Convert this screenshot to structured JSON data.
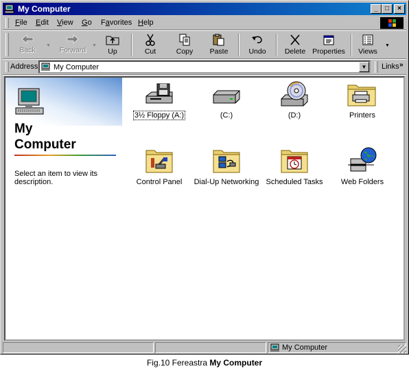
{
  "window": {
    "title": "My Computer",
    "controls": {
      "minimize": "_",
      "maximize": "□",
      "close": "×"
    }
  },
  "menubar": {
    "items": [
      {
        "label": "File",
        "underline": "F"
      },
      {
        "label": "Edit",
        "underline": "E"
      },
      {
        "label": "View",
        "underline": "V"
      },
      {
        "label": "Go",
        "underline": "G"
      },
      {
        "label": "Favorites",
        "underline": "a"
      },
      {
        "label": "Help",
        "underline": "H"
      }
    ]
  },
  "toolbar": {
    "back": "Back",
    "forward": "Forward",
    "up": "Up",
    "cut": "Cut",
    "copy": "Copy",
    "paste": "Paste",
    "undo": "Undo",
    "delete": "Delete",
    "properties": "Properties",
    "views": "Views"
  },
  "addressbar": {
    "label": "Address",
    "value": "My Computer",
    "links": "Links"
  },
  "leftpane": {
    "title_line1": "My",
    "title_line2": "Computer",
    "description": "Select an item to view its description."
  },
  "items": [
    {
      "label": "3½ Floppy (A:)",
      "icon": "floppy-drive-icon"
    },
    {
      "label": "(C:)",
      "icon": "hard-drive-icon"
    },
    {
      "label": "(D:)",
      "icon": "cd-drive-icon"
    },
    {
      "label": "Printers",
      "icon": "printers-folder-icon"
    },
    {
      "label": "Control Panel",
      "icon": "control-panel-icon"
    },
    {
      "label": "Dial-Up Networking",
      "icon": "dialup-networking-icon"
    },
    {
      "label": "Scheduled Tasks",
      "icon": "scheduled-tasks-icon"
    },
    {
      "label": "Web Folders",
      "icon": "web-folders-icon"
    }
  ],
  "statusbar": {
    "location": "My Computer"
  },
  "caption": {
    "prefix": "Fig.10 Fereastra",
    "bold": "My Computer"
  },
  "colors": {
    "titlebar_start": "#000080",
    "titlebar_end": "#1084d0",
    "face": "#c0c0c0"
  }
}
